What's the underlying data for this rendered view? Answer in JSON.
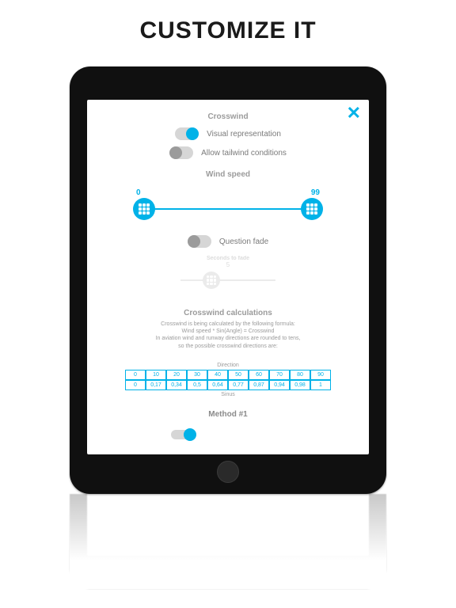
{
  "hero": {
    "title": "CUSTOMIZE IT"
  },
  "colors": {
    "accent": "#00b2e8"
  },
  "modal": {
    "close_label": "✕",
    "sections": {
      "crosswind": {
        "title": "Crosswind",
        "visual_rep": {
          "label": "Visual representation",
          "on": true
        },
        "allow_tailwind": {
          "label": "Allow tailwind conditions",
          "on": false
        }
      },
      "wind_speed": {
        "title": "Wind speed",
        "min_value": "0",
        "max_value": "99"
      },
      "question_fade": {
        "label": "Question fade",
        "on": false,
        "seconds_label": "Seconds to fade",
        "seconds_value": "5"
      },
      "calculations": {
        "title": "Crosswind calculations",
        "line1": "Crosswind is being calculated by the following formula:",
        "line2": "Wind speed * Sin(Angle) = Crosswind",
        "line3": "In aviation wind and runway directions are rounded to tens,",
        "line4": "so the possible crosswind directions are:"
      },
      "table": {
        "top_caption": "Direction",
        "bottom_caption": "Sinus",
        "directions": [
          "0",
          "10",
          "20",
          "30",
          "40",
          "50",
          "60",
          "70",
          "80",
          "90"
        ],
        "sinus": [
          "0",
          "0,17",
          "0,34",
          "0,5",
          "0,64",
          "0,77",
          "0,87",
          "0,94",
          "0,98",
          "1"
        ]
      },
      "method": {
        "title": "Method #1"
      }
    }
  }
}
